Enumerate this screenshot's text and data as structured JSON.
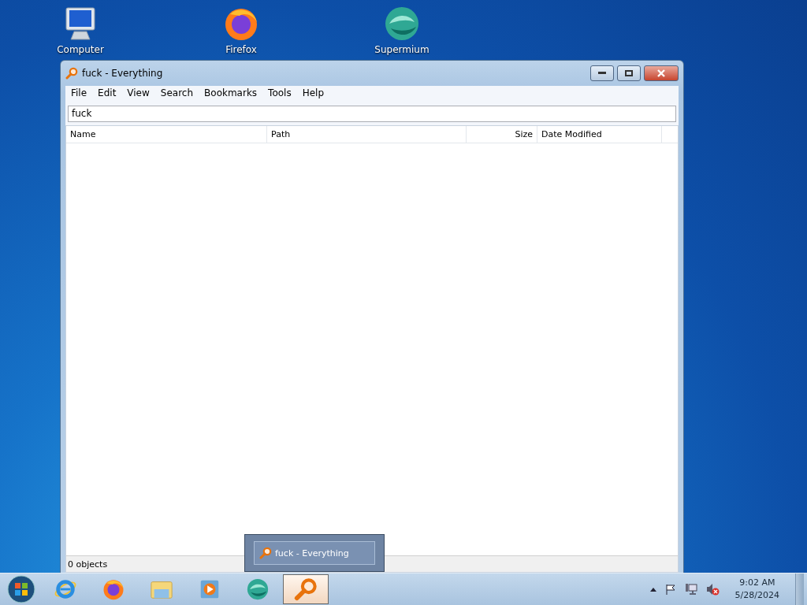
{
  "desktop_icons": [
    {
      "kind": "computer",
      "label": "Computer"
    },
    {
      "kind": "firefox",
      "label": "Firefox"
    },
    {
      "kind": "supermium",
      "label": "Supermium"
    }
  ],
  "window": {
    "title": "fuck - Everything",
    "menu": [
      "File",
      "Edit",
      "View",
      "Search",
      "Bookmarks",
      "Tools",
      "Help"
    ],
    "search": {
      "value": "fuck"
    },
    "columns": [
      "Name",
      "Path",
      "Size",
      "Date Modified"
    ],
    "status_bar": "0 objects"
  },
  "taskbar": {
    "buttons": [
      {
        "kind": "ie",
        "selected": false
      },
      {
        "kind": "firefox",
        "selected": false
      },
      {
        "kind": "explorer",
        "selected": false
      },
      {
        "kind": "media",
        "selected": false
      },
      {
        "kind": "supermium",
        "selected": false
      },
      {
        "kind": "everything",
        "selected": true
      }
    ],
    "thumbnail": {
      "title": "fuck - Everything"
    },
    "clock": {
      "time": "9:02 AM",
      "date": "5/28/2024"
    }
  }
}
